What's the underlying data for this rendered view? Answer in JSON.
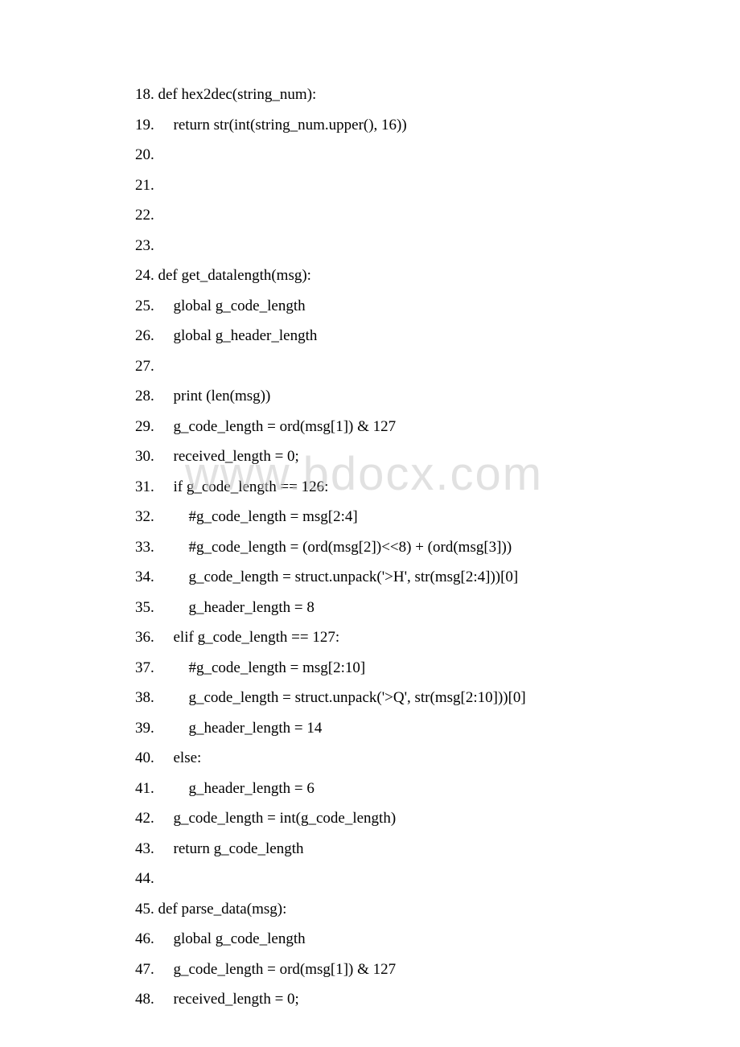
{
  "watermark": "www.bdocx.com",
  "lines": [
    {
      "num": "18.",
      "code": "def hex2dec(string_num):  "
    },
    {
      "num": "19.",
      "code": "    return str(int(string_num.upper(), 16))  "
    },
    {
      "num": "20.",
      "code": "  "
    },
    {
      "num": "21.",
      "code": "  "
    },
    {
      "num": "22.",
      "code": "  "
    },
    {
      "num": "23.",
      "code": "  "
    },
    {
      "num": "24.",
      "code": "def get_datalength(msg):  "
    },
    {
      "num": "25.",
      "code": "    global g_code_length  "
    },
    {
      "num": "26.",
      "code": "    global g_header_length    "
    },
    {
      "num": "27.",
      "code": "      "
    },
    {
      "num": "28.",
      "code": "    print (len(msg))  "
    },
    {
      "num": "29.",
      "code": "    g_code_length = ord(msg[1]) & 127  "
    },
    {
      "num": "30.",
      "code": "    received_length = 0;  "
    },
    {
      "num": "31.",
      "code": "    if g_code_length == 126:  "
    },
    {
      "num": "32.",
      "code": "        #g_code_length = msg[2:4]  "
    },
    {
      "num": "33.",
      "code": "        #g_code_length = (ord(msg[2])<<8) + (ord(msg[3]))  "
    },
    {
      "num": "34.",
      "code": "        g_code_length = struct.unpack('>H', str(msg[2:4]))[0]  "
    },
    {
      "num": "35.",
      "code": "        g_header_length = 8  "
    },
    {
      "num": "36.",
      "code": "    elif g_code_length == 127:  "
    },
    {
      "num": "37.",
      "code": "        #g_code_length = msg[2:10]  "
    },
    {
      "num": "38.",
      "code": "        g_code_length = struct.unpack('>Q', str(msg[2:10]))[0]  "
    },
    {
      "num": "39.",
      "code": "        g_header_length = 14  "
    },
    {
      "num": "40.",
      "code": "    else:  "
    },
    {
      "num": "41.",
      "code": "        g_header_length = 6  "
    },
    {
      "num": "42.",
      "code": "    g_code_length = int(g_code_length)  "
    },
    {
      "num": "43.",
      "code": "    return g_code_length  "
    },
    {
      "num": "44.",
      "code": "          "
    },
    {
      "num": "45.",
      "code": "def parse_data(msg):  "
    },
    {
      "num": "46.",
      "code": "    global g_code_length  "
    },
    {
      "num": "47.",
      "code": "    g_code_length = ord(msg[1]) & 127  "
    },
    {
      "num": "48.",
      "code": "    received_length = 0;  "
    }
  ]
}
